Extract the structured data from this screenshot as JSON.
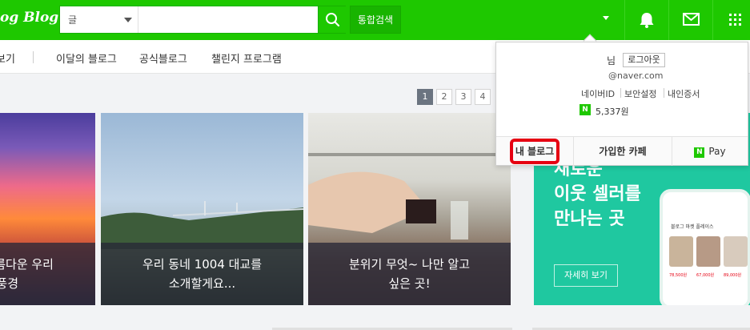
{
  "header": {
    "logo_text": "og Blog",
    "search": {
      "scope": "글",
      "value": "",
      "placeholder": ""
    },
    "integrated_search_label": "통합검색",
    "icons": [
      "search-icon",
      "caret-down-icon",
      "bell-icon",
      "mail-icon",
      "apps-grid-icon"
    ]
  },
  "subnav": {
    "items": [
      "보기",
      "이달의 블로그",
      "공식블로그",
      "챌린지 프로그램"
    ]
  },
  "pagination": [
    "1",
    "2",
    "3",
    "4"
  ],
  "cards": [
    {
      "line1": "름다운 우리",
      "line2": "풍경"
    },
    {
      "line1": "우리 동네 1004 대교를",
      "line2": "소개할게요..."
    },
    {
      "line1": "분위기 무엇~ 나만 알고",
      "line2": "싶은 곳!"
    }
  ],
  "promo": {
    "lines": [
      "새로운",
      "이웃 셀러를",
      "만나는 곳"
    ],
    "button": "자세히 보기",
    "phone_title": "블로그 마켓 플레이스",
    "prices": [
      "78,500원",
      "67,000원",
      "89,000원"
    ]
  },
  "dropdown": {
    "nim": "님",
    "logout": "로그아웃",
    "email": "@naver.com",
    "links": [
      "네이버ID",
      "보안설정",
      "내인증서"
    ],
    "npay_badge": "N",
    "points": "5,337원",
    "tabs": {
      "my_blog": "내 블로그",
      "joined_cafe": "가입한 카페",
      "pay": "Pay"
    }
  },
  "colors": {
    "brand_green": "#1ec800",
    "highlight_red": "#e60012",
    "promo_teal": "#1fc8a0"
  }
}
